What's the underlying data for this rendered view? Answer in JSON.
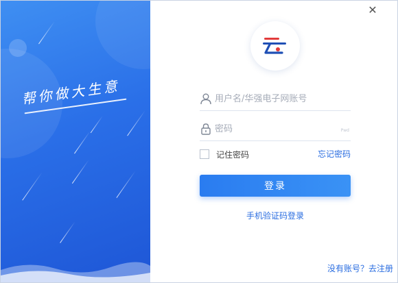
{
  "window": {
    "close_label": "✕"
  },
  "promo": {
    "slogan": "帮你做大生意"
  },
  "logo": {
    "icon": "cloud-logo-icon"
  },
  "login_form": {
    "username_placeholder": "用户名/华强电子网账号",
    "password_placeholder": "密码",
    "password_hint": "Pwd",
    "remember_label": "记住密码",
    "forgot_label": "忘记密码",
    "login_button": "登录",
    "sms_login_label": "手机验证码登录",
    "register_label": "没有账号？去注册"
  },
  "colors": {
    "accent": "#2a7cf0",
    "link": "#2a6de0",
    "promo_top": "#3f8ff2",
    "promo_bottom": "#1e56d6"
  }
}
